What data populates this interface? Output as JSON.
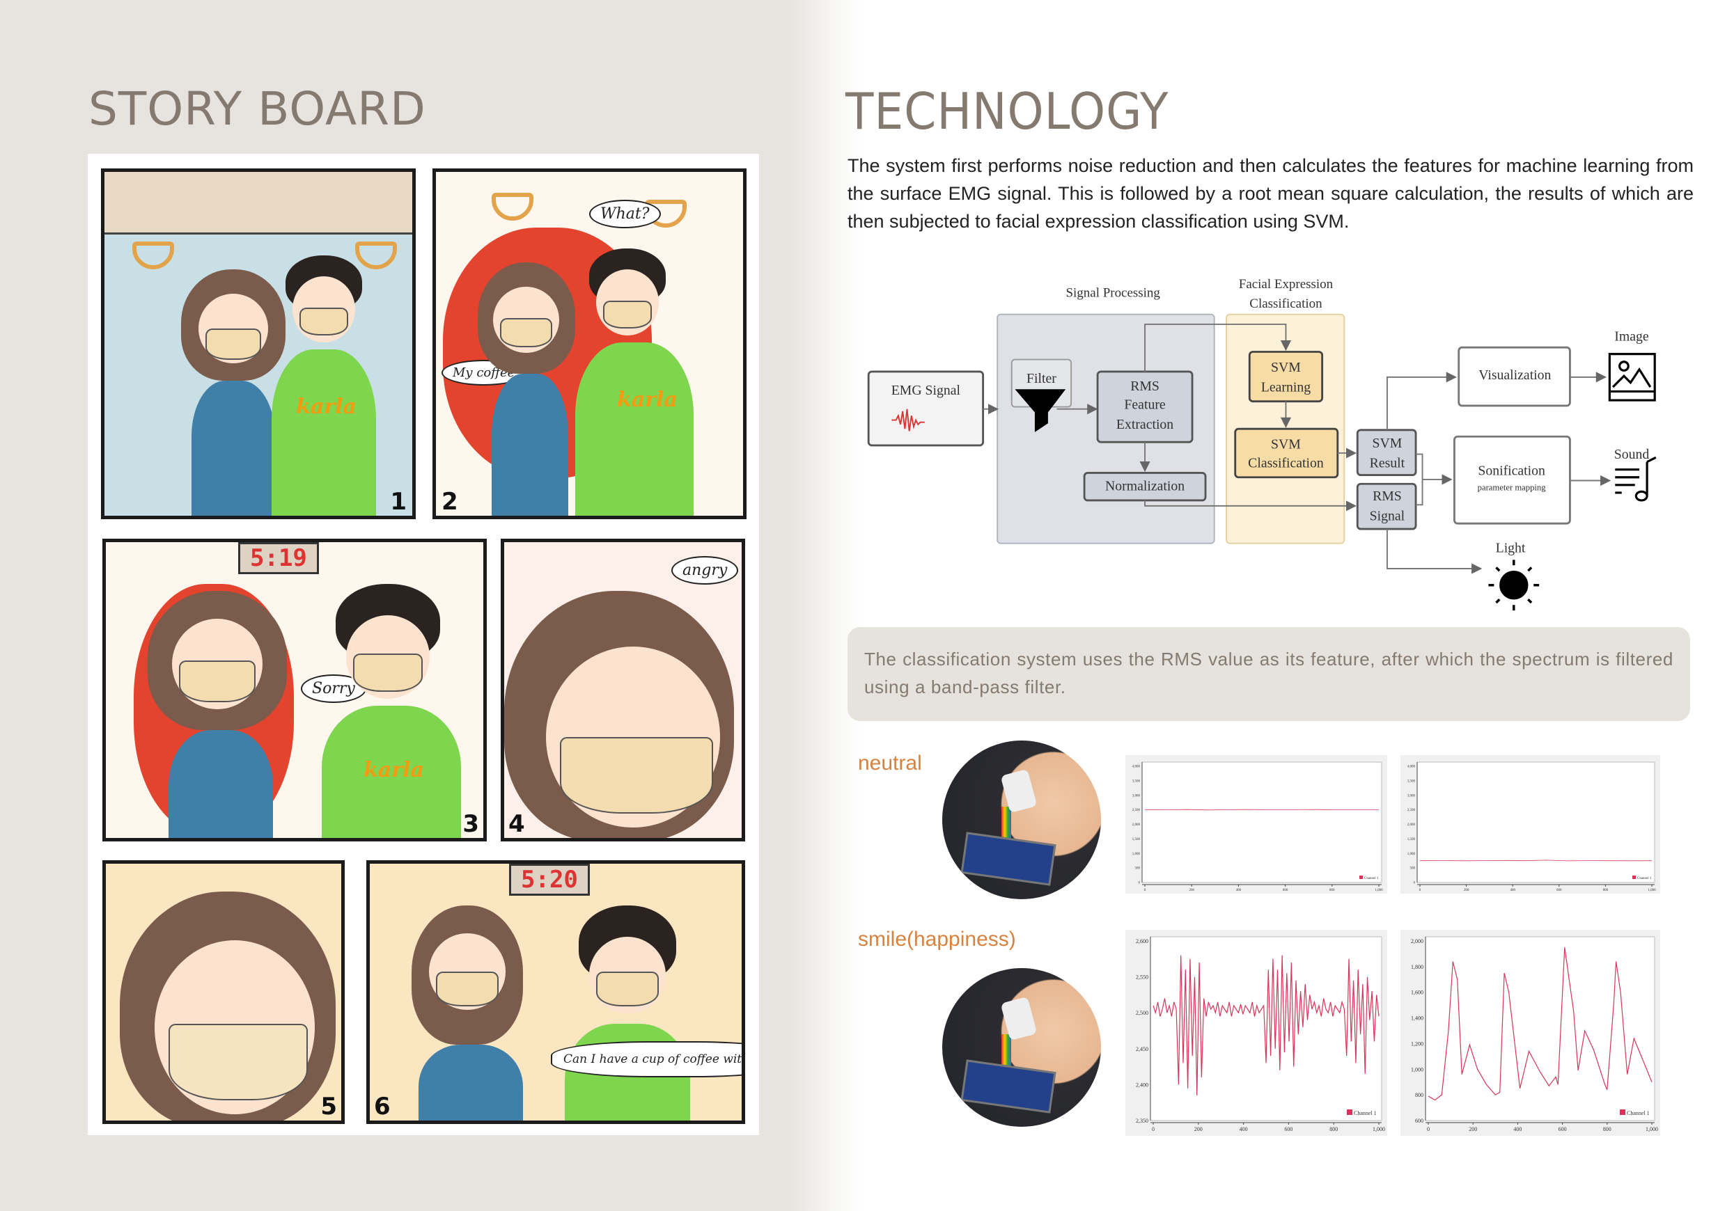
{
  "storyboard": {
    "title": "STORY BOARD",
    "panels": [
      {
        "number": "1",
        "texts": {
          "shirt": "karla"
        }
      },
      {
        "number": "2",
        "texts": {
          "bubble_what": "What?",
          "bubble_coffee": "My coffee",
          "shirt": "karla"
        }
      },
      {
        "number": "3",
        "texts": {
          "clock": "5:19",
          "bubble_sorry": "Sorry",
          "shirt": "karla"
        }
      },
      {
        "number": "4",
        "texts": {
          "bubble_angry": "angry"
        }
      },
      {
        "number": "5",
        "texts": {}
      },
      {
        "number": "6",
        "texts": {
          "clock": "5:20",
          "bubble_ask": "Can I have a cup of coffee with you?"
        }
      }
    ]
  },
  "technology": {
    "title": "TECHNOLOGY",
    "intro": "The system first performs noise reduction and then calculates the features for machine learning from the surface EMG signal. This is followed by a root mean square calculation, the results of which are then subjected to facial expression classification using SVM.",
    "callout": "The classification system uses the RMS value as its feature, after which the spectrum is filtered using a band-pass filter."
  },
  "diagram": {
    "group_signal": "Signal Processing",
    "group_facial_1": "Facial Expression",
    "group_facial_2": "Classification",
    "emg": "EMG Signal",
    "filter": "Filter",
    "rms_1": "RMS",
    "rms_2": "Feature",
    "rms_3": "Extraction",
    "normalization": "Normalization",
    "svm_learning_1": "SVM",
    "svm_learning_2": "Learning",
    "svm_class_1": "SVM",
    "svm_class_2": "Classification",
    "svm_result_1": "SVM",
    "svm_result_2": "Result",
    "rms_signal_1": "RMS",
    "rms_signal_2": "Signal",
    "visualization": "Visualization",
    "sonification": "Sonification",
    "sonification_sub": "parameter mapping",
    "image": "Image",
    "sound": "Sound",
    "light": "Light",
    "colors": {
      "gray_panel": "#dfe1e6",
      "yellow_panel": "#fdf1d9",
      "svm_box": "#f7dca6",
      "gray_box": "#cfd3dc"
    }
  },
  "expressions": [
    {
      "label": "neutral"
    },
    {
      "label": "smile(happiness)"
    }
  ],
  "chart_data": [
    {
      "type": "line",
      "title": "neutral raw EMG",
      "legend": "Channel 1",
      "legend_position": "bottom-right",
      "xlim": [
        0,
        1000
      ],
      "ylim": [
        0,
        4000
      ],
      "xticks": [
        "0",
        "200",
        "400",
        "600",
        "800",
        "1,000"
      ],
      "yticks": [
        "0",
        "500",
        "1,000",
        "1,500",
        "2,000",
        "2,500",
        "3,000",
        "3,500",
        "4,000"
      ],
      "values": [
        2505,
        2500,
        2510,
        2495,
        2505,
        2510,
        2500,
        2505,
        2510,
        2500,
        2505,
        2500
      ]
    },
    {
      "type": "line",
      "title": "neutral RMS",
      "legend": "Channel 1",
      "legend_position": "bottom-right",
      "xlim": [
        0,
        1000
      ],
      "ylim": [
        0,
        4000
      ],
      "xticks": [
        "0",
        "200",
        "400",
        "600",
        "800",
        "1,000"
      ],
      "yticks": [
        "0",
        "500",
        "1,000",
        "1,500",
        "2,000",
        "2,500",
        "3,000",
        "3,500",
        "4,000"
      ],
      "values": [
        750,
        755,
        748,
        752,
        760,
        750,
        770,
        745,
        752,
        750,
        748,
        750
      ]
    },
    {
      "type": "line",
      "title": "smile raw EMG",
      "legend": "Channel 1",
      "legend_position": "bottom-right",
      "xlim": [
        0,
        1000
      ],
      "ylim": [
        2350,
        2600
      ],
      "xticks": [
        "0",
        "200",
        "400",
        "600",
        "800",
        "1,000"
      ],
      "yticks": [
        "2,350",
        "2,400",
        "2,450",
        "2,500",
        "2,550",
        "2,600"
      ],
      "values": [
        2510,
        2500,
        2515,
        2495,
        2505,
        2520,
        2500,
        2510,
        2495,
        2515,
        2505,
        2400,
        2580,
        2430,
        2560,
        2395,
        2575,
        2440,
        2550,
        2385,
        2570,
        2410,
        2520,
        2495,
        2515,
        2505,
        2510,
        2500,
        2515,
        2495,
        2510,
        2505,
        2500,
        2515,
        2495,
        2510,
        2505,
        2500,
        2512,
        2498,
        2510,
        2505,
        2500,
        2515,
        2495,
        2510,
        2500,
        2505,
        2510,
        2430,
        2560,
        2440,
        2575,
        2450,
        2560,
        2420,
        2580,
        2445,
        2555,
        2460,
        2570,
        2425,
        2545,
        2470,
        2530,
        2480,
        2540,
        2490,
        2525,
        2505,
        2515,
        2500,
        2510,
        2495,
        2520,
        2505,
        2500,
        2515,
        2495,
        2510,
        2505,
        2500,
        2515,
        2505,
        2440,
        2575,
        2460,
        2545,
        2430,
        2560,
        2470,
        2540,
        2415,
        2550,
        2490,
        2530,
        2460,
        2525,
        2495
      ]
    },
    {
      "type": "line",
      "title": "smile RMS",
      "legend": "Channel 1",
      "legend_position": "bottom-right",
      "xlim": [
        0,
        1000
      ],
      "ylim": [
        600,
        2000
      ],
      "xticks": [
        "0",
        "200",
        "400",
        "600",
        "800",
        "1,000"
      ],
      "yticks": [
        "600",
        "800",
        "1,000",
        "1,200",
        "1,400",
        "1,600",
        "1,800",
        "2,000"
      ],
      "x": [
        0,
        30,
        60,
        90,
        110,
        130,
        150,
        185,
        220,
        260,
        300,
        320,
        340,
        360,
        410,
        450,
        500,
        540,
        570,
        580,
        610,
        630,
        650,
        670,
        700,
        740,
        790,
        800,
        830,
        840,
        860,
        890,
        920,
        960,
        1000
      ],
      "values": [
        790,
        760,
        800,
        1300,
        1840,
        1700,
        960,
        1190,
        1000,
        880,
        800,
        820,
        1750,
        1600,
        850,
        1140,
        980,
        870,
        940,
        880,
        1950,
        1700,
        1450,
        990,
        1300,
        1150,
        880,
        840,
        1520,
        1840,
        1600,
        960,
        1240,
        1070,
        900
      ]
    }
  ]
}
